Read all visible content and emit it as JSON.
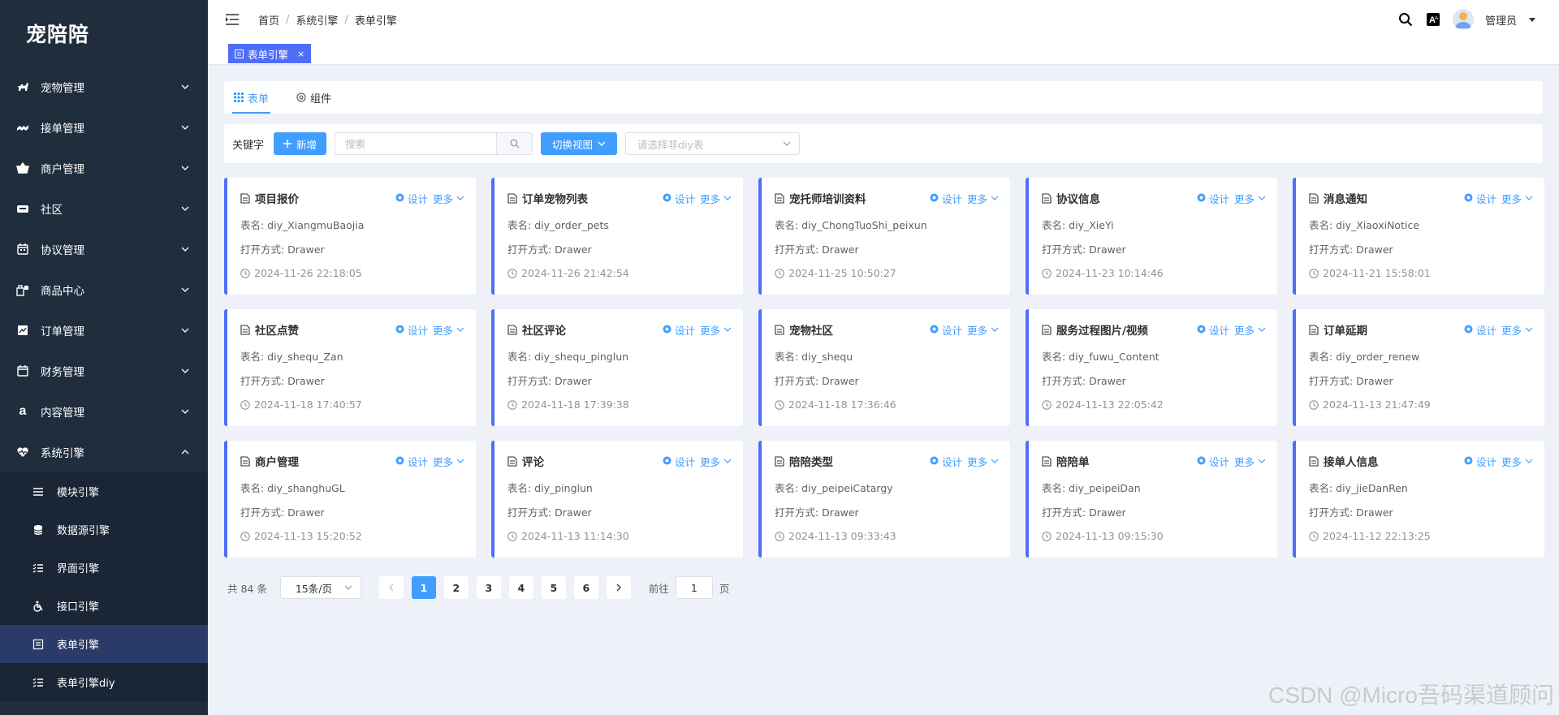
{
  "app": {
    "logo": "宠陪陪"
  },
  "sidebar": {
    "menus": [
      {
        "label": "宠物管理",
        "icon": "pet-icon"
      },
      {
        "label": "接单管理",
        "icon": "handshake-icon"
      },
      {
        "label": "商户管理",
        "icon": "basket-icon"
      },
      {
        "label": "社区",
        "icon": "community-icon"
      },
      {
        "label": "协议管理",
        "icon": "calendar-icon"
      },
      {
        "label": "商品中心",
        "icon": "goods-icon"
      },
      {
        "label": "订单管理",
        "icon": "order-icon"
      },
      {
        "label": "财务管理",
        "icon": "finance-icon"
      },
      {
        "label": "内容管理",
        "icon": "content-icon"
      },
      {
        "label": "系统引擎",
        "icon": "heartbeat-icon"
      }
    ],
    "submenus": [
      {
        "label": "模块引擎",
        "icon": "list-icon"
      },
      {
        "label": "数据源引擎",
        "icon": "database-icon"
      },
      {
        "label": "界面引擎",
        "icon": "checklist-icon"
      },
      {
        "label": "接口引擎",
        "icon": "wheelchair-icon"
      },
      {
        "label": "表单引擎",
        "icon": "form-icon"
      },
      {
        "label": "表单引擎diy",
        "icon": "checklist-icon"
      }
    ]
  },
  "header": {
    "breadcrumb": [
      "首页",
      "系统引擎",
      "表单引擎"
    ],
    "user": "管理员"
  },
  "tagsbar": {
    "tag_label": "表单引擎",
    "close": "×"
  },
  "tabs": [
    {
      "label": "表单",
      "icon": "grid-icon"
    },
    {
      "label": "组件",
      "icon": "component-icon"
    }
  ],
  "filter": {
    "keyword_label": "关键字",
    "add_label": "新增",
    "search_placeholder": "搜索",
    "switch_label": "切换视图",
    "select_placeholder": "请选择非diy表"
  },
  "card_labels": {
    "design": "设计",
    "more": "更多"
  },
  "cards": [
    {
      "title": "项目报价",
      "table": "表名: diy_XiangmuBaojia",
      "open": "打开方式: Drawer",
      "time": "2024-11-26 22:18:05"
    },
    {
      "title": "订单宠物列表",
      "table": "表名: diy_order_pets",
      "open": "打开方式: Drawer",
      "time": "2024-11-26 21:42:54"
    },
    {
      "title": "宠托师培训资料",
      "table": "表名: diy_ChongTuoShi_peixun",
      "open": "打开方式: Drawer",
      "time": "2024-11-25 10:50:27"
    },
    {
      "title": "协议信息",
      "table": "表名: diy_XieYi",
      "open": "打开方式: Drawer",
      "time": "2024-11-23 10:14:46"
    },
    {
      "title": "消息通知",
      "table": "表名: diy_XiaoxiNotice",
      "open": "打开方式: Drawer",
      "time": "2024-11-21 15:58:01"
    },
    {
      "title": "社区点赞",
      "table": "表名: diy_shequ_Zan",
      "open": "打开方式: Drawer",
      "time": "2024-11-18 17:40:57"
    },
    {
      "title": "社区评论",
      "table": "表名: diy_shequ_pinglun",
      "open": "打开方式: Drawer",
      "time": "2024-11-18 17:39:38"
    },
    {
      "title": "宠物社区",
      "table": "表名: diy_shequ",
      "open": "打开方式: Drawer",
      "time": "2024-11-18 17:36:46"
    },
    {
      "title": "服务过程图片/视频",
      "table": "表名: diy_fuwu_Content",
      "open": "打开方式: Drawer",
      "time": "2024-11-13 22:05:42"
    },
    {
      "title": "订单延期",
      "table": "表名: diy_order_renew",
      "open": "打开方式: Drawer",
      "time": "2024-11-13 21:47:49"
    },
    {
      "title": "商户管理",
      "table": "表名: diy_shanghuGL",
      "open": "打开方式: Drawer",
      "time": "2024-11-13 15:20:52"
    },
    {
      "title": "评论",
      "table": "表名: diy_pinglun",
      "open": "打开方式: Drawer",
      "time": "2024-11-13 11:14:30"
    },
    {
      "title": "陪陪类型",
      "table": "表名: diy_peipeiCatargy",
      "open": "打开方式: Drawer",
      "time": "2024-11-13 09:33:43"
    },
    {
      "title": "陪陪单",
      "table": "表名: diy_peipeiDan",
      "open": "打开方式: Drawer",
      "time": "2024-11-13 09:15:30"
    },
    {
      "title": "接单人信息",
      "table": "表名: diy_jieDanRen",
      "open": "打开方式: Drawer",
      "time": "2024-11-12 22:13:25"
    }
  ],
  "pagination": {
    "total": "共 84 条",
    "page_size": "15条/页",
    "pages": [
      "1",
      "2",
      "3",
      "4",
      "5",
      "6"
    ],
    "current": "1",
    "goto_label": "前往",
    "goto_value": "1",
    "page_suffix": "页"
  },
  "watermark": "CSDN @Micro吾码渠道顾问",
  "colors": {
    "sidebar_bg": "#1f2d3d",
    "accent": "#409eff",
    "card_border": "#4f6ef7",
    "page_bg": "#eef1f8"
  }
}
